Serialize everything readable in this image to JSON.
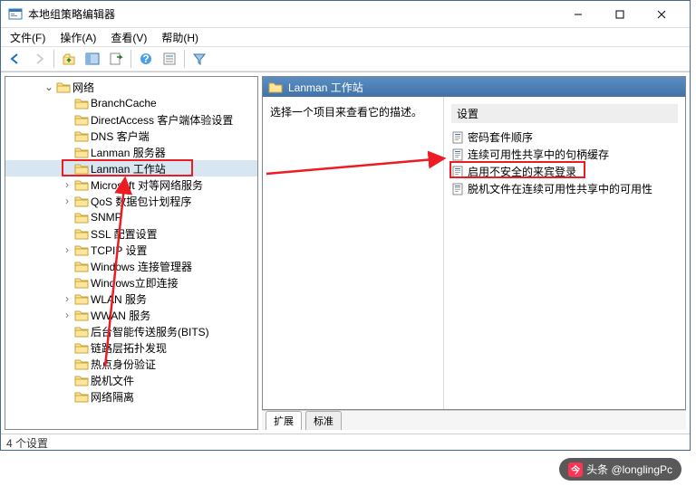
{
  "window": {
    "title": "本地组策略编辑器"
  },
  "menu": {
    "file": "文件(F)",
    "action": "操作(A)",
    "view": "查看(V)",
    "help": "帮助(H)"
  },
  "statusbar": {
    "text": "4 个设置"
  },
  "tree": {
    "parent_label": "网络",
    "items": [
      {
        "label": "BranchCache",
        "expandable": false
      },
      {
        "label": "DirectAccess 客户端体验设置",
        "expandable": false
      },
      {
        "label": "DNS 客户端",
        "expandable": false
      },
      {
        "label": "Lanman 服务器",
        "expandable": false
      },
      {
        "label": "Lanman 工作站",
        "expandable": false,
        "selected": true,
        "highlighted": true
      },
      {
        "label": "Microsoft 对等网络服务",
        "expandable": true
      },
      {
        "label": "QoS 数据包计划程序",
        "expandable": true
      },
      {
        "label": "SNMP",
        "expandable": false
      },
      {
        "label": "SSL 配置设置",
        "expandable": false
      },
      {
        "label": "TCPIP 设置",
        "expandable": true
      },
      {
        "label": "Windows 连接管理器",
        "expandable": false
      },
      {
        "label": "Windows立即连接",
        "expandable": false
      },
      {
        "label": "WLAN 服务",
        "expandable": true
      },
      {
        "label": "WWAN 服务",
        "expandable": true
      },
      {
        "label": "后台智能传送服务(BITS)",
        "expandable": false
      },
      {
        "label": "链路层拓扑发现",
        "expandable": false
      },
      {
        "label": "热点身份验证",
        "expandable": false
      },
      {
        "label": "脱机文件",
        "expandable": false
      },
      {
        "label": "网络隔离",
        "expandable": false
      }
    ]
  },
  "right": {
    "header": "Lanman 工作站",
    "description_prompt": "选择一个项目来查看它的描述。",
    "settings_header": "设置",
    "settings": [
      {
        "label": "密码套件顺序"
      },
      {
        "label": "连续可用性共享中的句柄缓存"
      },
      {
        "label": "启用不安全的来宾登录",
        "highlighted": true
      },
      {
        "label": "脱机文件在连续可用性共享中的可用性"
      }
    ]
  },
  "tabs": {
    "extended": "扩展",
    "standard": "标准"
  },
  "watermark": {
    "text": "头条 @longlingPc"
  }
}
